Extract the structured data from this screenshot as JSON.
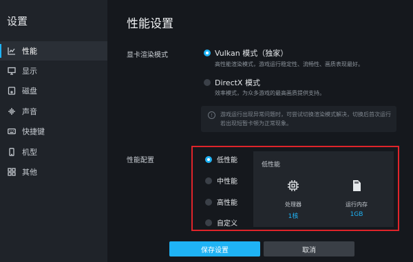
{
  "sidebar": {
    "title": "设置",
    "items": [
      {
        "label": "性能",
        "icon": "chart-icon"
      },
      {
        "label": "显示",
        "icon": "monitor-icon"
      },
      {
        "label": "磁盘",
        "icon": "disk-icon"
      },
      {
        "label": "声音",
        "icon": "sound-icon"
      },
      {
        "label": "快捷键",
        "icon": "keyboard-icon"
      },
      {
        "label": "机型",
        "icon": "phone-icon"
      },
      {
        "label": "其他",
        "icon": "grid-icon"
      }
    ],
    "active_index": 0
  },
  "main": {
    "title": "性能设置",
    "render_mode": {
      "label": "显卡渲染模式",
      "options": [
        {
          "label": "Vulkan 模式（独家）",
          "desc": "高性能渲染模式，游戏运行稳定性、流畅性、画质表现最好。",
          "checked": true
        },
        {
          "label": "DirectX 模式",
          "desc": "效率模式，为众多游戏的最高画质提供支持。",
          "checked": false
        }
      ],
      "tip": "游戏运行出现异常问题时，可尝试切换渲染模式解决，切换后首次运行若出现短暂卡顿为正常现象。"
    },
    "performance": {
      "label": "性能配置",
      "options": [
        {
          "label": "低性能",
          "checked": true
        },
        {
          "label": "中性能",
          "checked": false
        },
        {
          "label": "高性能",
          "checked": false
        },
        {
          "label": "自定义",
          "checked": false
        }
      ],
      "panel": {
        "title": "低性能",
        "cpu": {
          "label": "处理器",
          "value": "1核",
          "icon": "cpu-icon"
        },
        "memory": {
          "label": "运行内存",
          "value": "1GB",
          "icon": "memory-card-icon"
        }
      }
    },
    "buttons": {
      "save": "保存设置",
      "cancel": "取消"
    }
  },
  "colors": {
    "accent": "#1fb3f5",
    "highlight_border": "#e0242a",
    "background": "#15181d",
    "sidebar": "#1f2329"
  }
}
